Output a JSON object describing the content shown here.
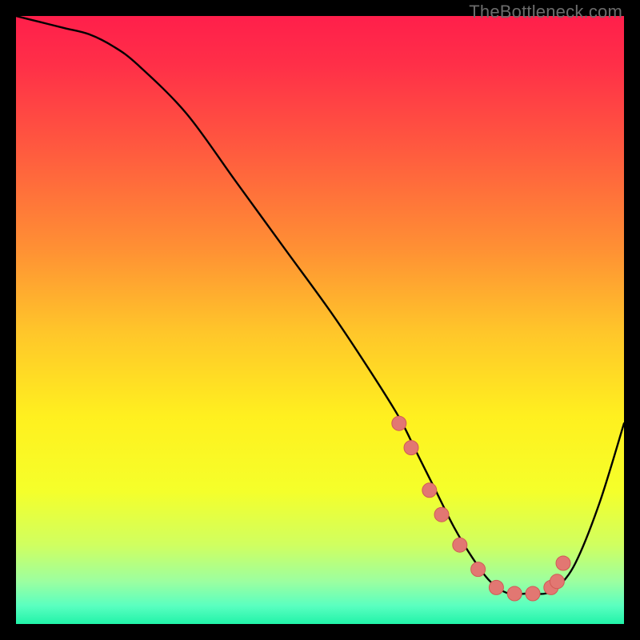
{
  "watermark": "TheBottleneck.com",
  "colors": {
    "frame": "#000000",
    "curve_stroke": "#000000",
    "marker_fill": "#e27772",
    "marker_stroke": "#d05b55",
    "gradient_stops": [
      {
        "offset": 0.0,
        "color": "#ff1f4b"
      },
      {
        "offset": 0.08,
        "color": "#ff2f48"
      },
      {
        "offset": 0.22,
        "color": "#ff5a3f"
      },
      {
        "offset": 0.38,
        "color": "#ff8f34"
      },
      {
        "offset": 0.52,
        "color": "#ffc62a"
      },
      {
        "offset": 0.66,
        "color": "#fff01f"
      },
      {
        "offset": 0.78,
        "color": "#f5ff2a"
      },
      {
        "offset": 0.87,
        "color": "#d0ff60"
      },
      {
        "offset": 0.93,
        "color": "#9cffa0"
      },
      {
        "offset": 0.97,
        "color": "#5affc0"
      },
      {
        "offset": 1.0,
        "color": "#21f3a9"
      }
    ]
  },
  "chart_data": {
    "type": "line",
    "title": "",
    "xlabel": "",
    "ylabel": "",
    "xlim": [
      0,
      100
    ],
    "ylim": [
      0,
      100
    ],
    "series": [
      {
        "name": "bottleneck-curve",
        "x": [
          0,
          4,
          8,
          12,
          16,
          20,
          28,
          36,
          44,
          52,
          58,
          63,
          66,
          69,
          72,
          75,
          78,
          81,
          84,
          87,
          89,
          92,
          96,
          100
        ],
        "y": [
          100,
          99,
          98,
          97,
          95,
          92,
          84,
          73,
          62,
          51,
          42,
          34,
          28,
          22,
          16,
          11,
          7,
          5,
          5,
          5,
          6,
          10,
          20,
          33
        ]
      }
    ],
    "markers": {
      "name": "highlight-points",
      "x": [
        63,
        65,
        68,
        70,
        73,
        76,
        79,
        82,
        85,
        88,
        89,
        90
      ],
      "y": [
        33,
        29,
        22,
        18,
        13,
        9,
        6,
        5,
        5,
        6,
        7,
        10
      ]
    }
  }
}
